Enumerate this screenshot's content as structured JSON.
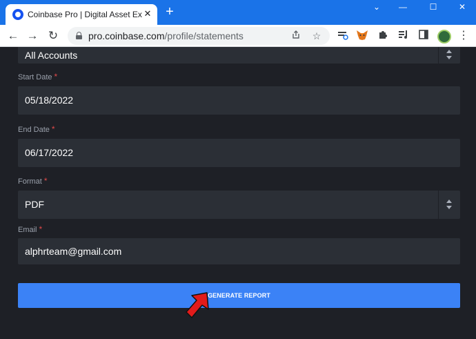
{
  "browser": {
    "tab_title": "Coinbase Pro | Digital Asset Exch",
    "tab_close": "✕",
    "new_tab": "+",
    "window_controls": {
      "minimize": "—",
      "maximize": "☐",
      "close": "✕",
      "dropdown": "⌄"
    },
    "url_host": "pro.coinbase.com",
    "url_path": "/profile/statements",
    "back": "←",
    "forward": "→",
    "reload": "↻",
    "menu": "⋮"
  },
  "form": {
    "account": {
      "value": "All Accounts"
    },
    "start_date": {
      "label": "Start Date",
      "required": "*",
      "value": "05/18/2022"
    },
    "end_date": {
      "label": "End Date",
      "required": "*",
      "value": "06/17/2022"
    },
    "format": {
      "label": "Format",
      "required": "*",
      "value": "PDF"
    },
    "email": {
      "label": "Email",
      "required": "*",
      "value": "alphrteam@gmail.com"
    },
    "submit": {
      "label": "GENERATE REPORT"
    }
  },
  "colors": {
    "tabstrip": "#1a73e8",
    "page_bg": "#1e2026",
    "field_bg": "#2b2f36",
    "button": "#3b82f6",
    "required": "#e24a4a",
    "pointer_arrow": "#e21b1b"
  },
  "icons": {
    "favicon": "coinbase-icon",
    "lock": "lock-icon",
    "share": "share-icon",
    "bookmark": "star-icon",
    "extensions": [
      "translate-extension-icon",
      "metamask-fox-icon",
      "puzzle-icon",
      "media-queue-icon",
      "side-panel-icon"
    ],
    "pointer": "red-arrow-icon"
  }
}
